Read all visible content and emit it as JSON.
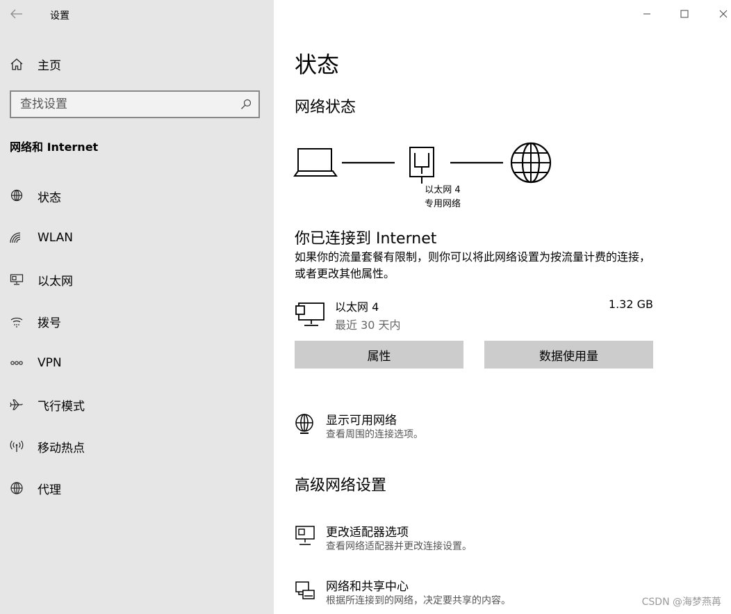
{
  "window": {
    "title": "设置"
  },
  "sidebar": {
    "home_label": "主页",
    "search_placeholder": "查找设置",
    "section_title": "网络和 Internet",
    "items": [
      {
        "label": "状态",
        "icon": "globe-status-icon"
      },
      {
        "label": "WLAN",
        "icon": "wifi-icon"
      },
      {
        "label": "以太网",
        "icon": "ethernet-icon"
      },
      {
        "label": "拨号",
        "icon": "dialup-icon"
      },
      {
        "label": "VPN",
        "icon": "vpn-icon"
      },
      {
        "label": "飞行模式",
        "icon": "airplane-icon"
      },
      {
        "label": "移动热点",
        "icon": "hotspot-icon"
      },
      {
        "label": "代理",
        "icon": "globe-icon"
      }
    ]
  },
  "main": {
    "page_title": "状态",
    "network_status_heading": "网络状态",
    "diagram": {
      "adapter_name": "以太网 4",
      "network_type": "专用网络"
    },
    "connected_title": "你已连接到 Internet",
    "connected_desc": "如果你的流量套餐有限制，则你可以将此网络设置为按流量计费的连接，或者更改其他属性。",
    "adapter": {
      "name": "以太网 4",
      "period": "最近 30 天内",
      "usage": "1.32 GB"
    },
    "buttons": {
      "properties": "属性",
      "data_usage": "数据使用量"
    },
    "show_networks": {
      "title": "显示可用网络",
      "subtitle": "查看周围的连接选项。"
    },
    "advanced_heading": "高级网络设置",
    "change_adapter": {
      "title": "更改适配器选项",
      "subtitle": "查看网络适配器并更改连接设置。"
    },
    "sharing_center": {
      "title": "网络和共享中心",
      "subtitle": "根据所连接到的网络，决定要共享的内容。"
    }
  },
  "watermark": "CSDN @海梦燕苒"
}
